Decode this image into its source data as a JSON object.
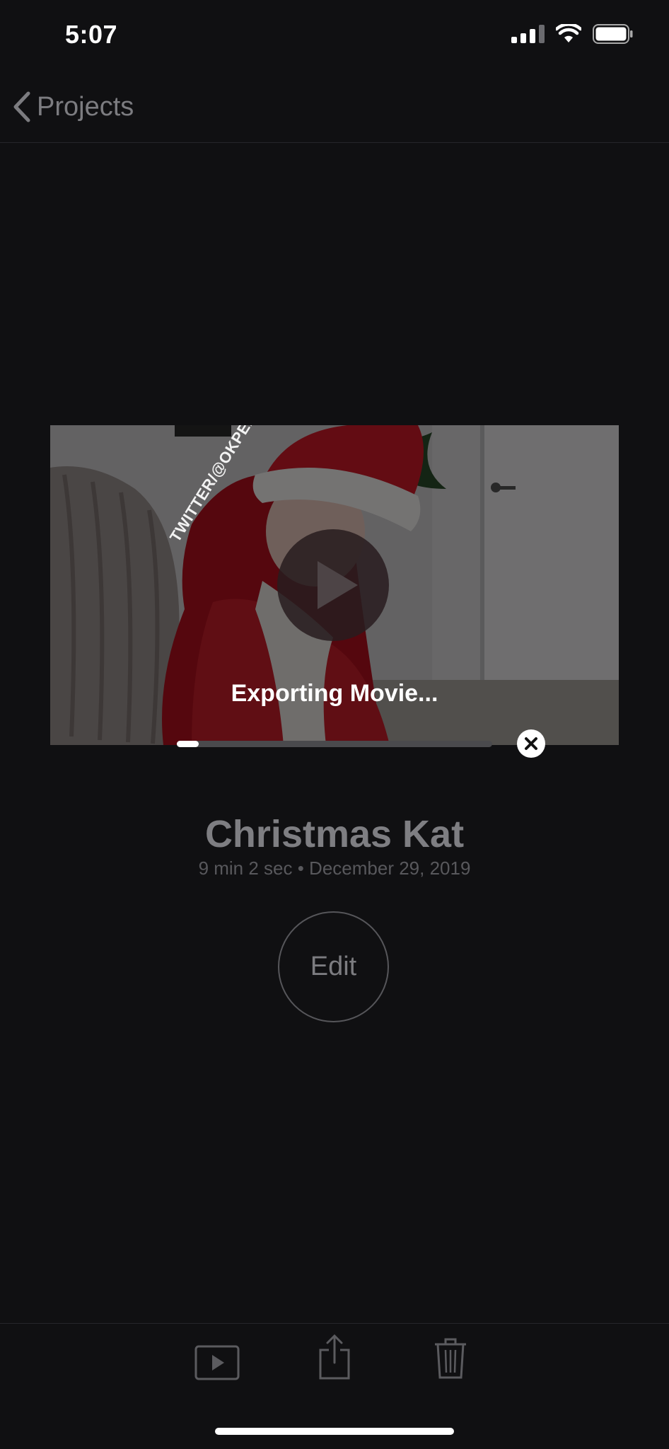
{
  "status_bar": {
    "time": "5:07",
    "icons": [
      "cellular-signal-icon",
      "wifi-icon",
      "battery-icon"
    ]
  },
  "nav": {
    "back_label": "Projects",
    "back_icon": "chevron-left-icon"
  },
  "preview": {
    "watermark": "TWITTER/@OKPEACHTOT",
    "play_icon": "play-icon",
    "export_label": "Exporting Movie...",
    "export_progress": 0.07,
    "cancel_icon": "close-icon"
  },
  "project": {
    "title": "Christmas Kat",
    "subtitle": "9 min 2 sec • December 29, 2019",
    "edit_label": "Edit"
  },
  "toolbar": {
    "items": [
      "play-movie-icon",
      "share-icon",
      "trash-icon"
    ]
  },
  "colors": {
    "background": "#101012",
    "muted_text": "#7c7c80",
    "dim_text": "#58585c",
    "accent_red": "#c8102e"
  }
}
